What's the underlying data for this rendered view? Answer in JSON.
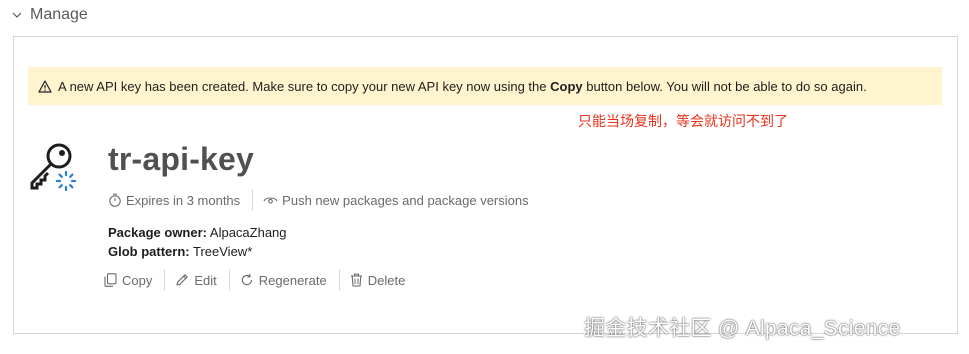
{
  "section": {
    "title": "Manage"
  },
  "alert": {
    "text_before": "A new API key has been created. Make sure to copy your new API key now using the ",
    "text_bold": "Copy",
    "text_after": " button below. You will not be able to do so again.",
    "background_color": "#fff4ce",
    "icon": "warning-icon"
  },
  "annotation": {
    "text": "只能当场复制，等会就访问不到了",
    "color": "#e8321e"
  },
  "api_key": {
    "name": "tr-api-key",
    "icon": "key-icon",
    "expires": "Expires in 3 months",
    "scope": "Push new packages and package versions",
    "package_owner_label": "Package owner:",
    "package_owner_value": "AlpacaZhang",
    "glob_pattern_label": "Glob pattern:",
    "glob_pattern_value": "TreeView*"
  },
  "actions": {
    "copy": "Copy",
    "edit": "Edit",
    "regenerate": "Regenerate",
    "delete": "Delete"
  },
  "watermark": {
    "text": "掘金技术社区 @ Alpaca_Science"
  }
}
